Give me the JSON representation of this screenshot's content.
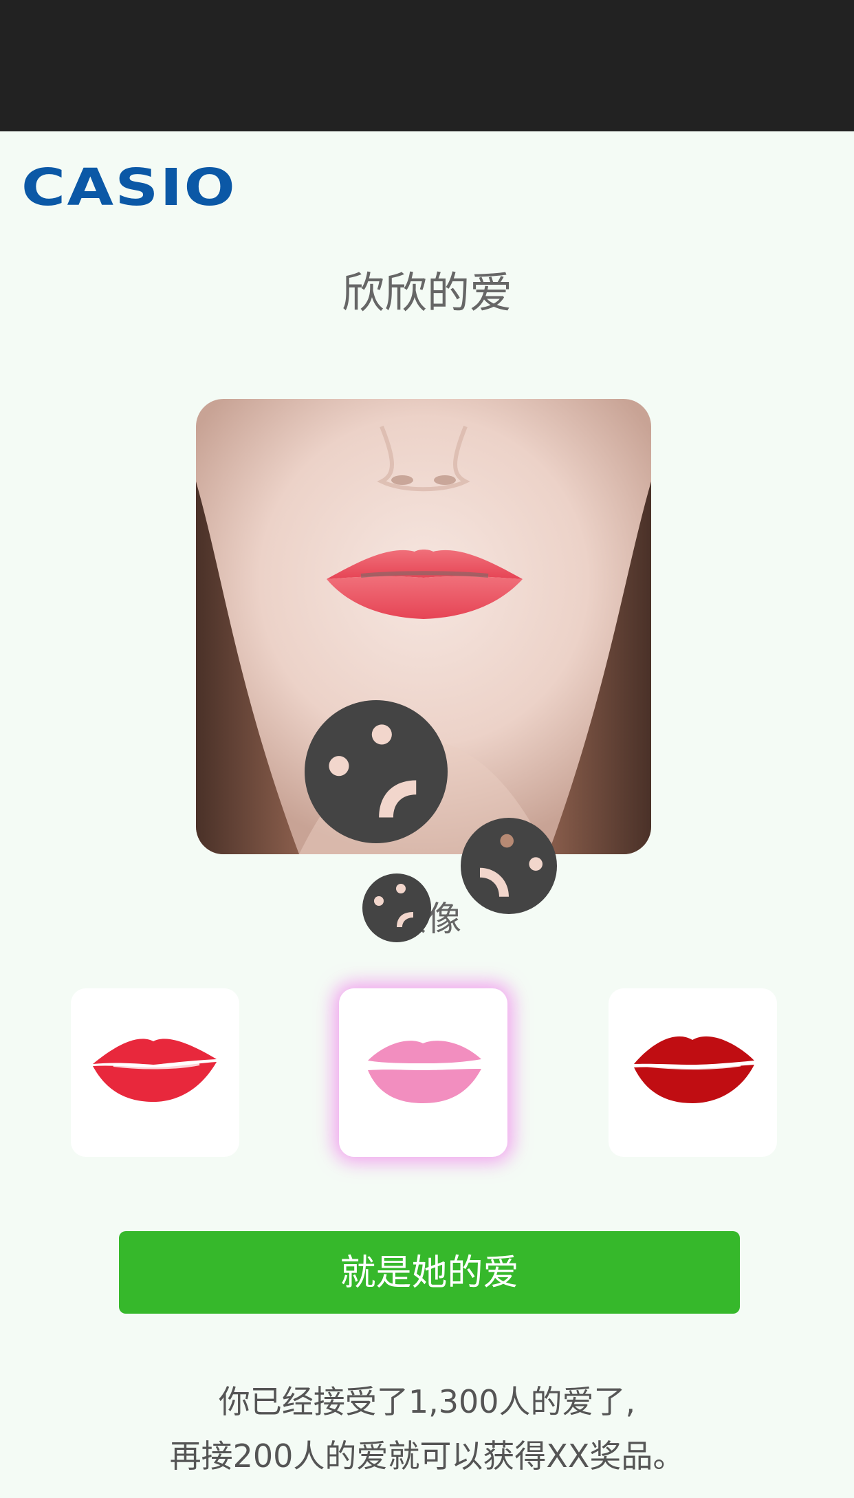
{
  "header": {
    "logo_text": "CASIO",
    "logo_color": "#0b58a6"
  },
  "title": "欣欣的爱",
  "avatar_label": "头像",
  "icons": {
    "face_icon": "sad-face-icon"
  },
  "lip_options": [
    {
      "name": "red-lips",
      "color": "#e8283c",
      "selected": false
    },
    {
      "name": "pink-lips",
      "color": "#f07ab4",
      "selected": true
    },
    {
      "name": "dark-red-lips",
      "color": "#c00d12",
      "selected": false
    }
  ],
  "button": {
    "label": "就是她的爱",
    "color": "#36b82b"
  },
  "info": {
    "line1": "你已经接受了1,300人的爱了,",
    "line2": "再接200人的爱就可以获得XX奖品。"
  }
}
